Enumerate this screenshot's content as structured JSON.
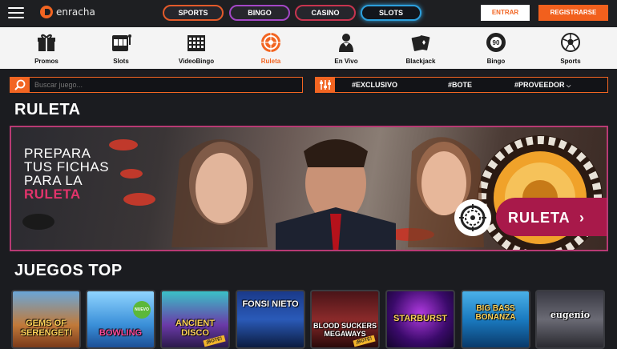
{
  "header": {
    "logo_text": "enracha",
    "tabs": [
      "SPORTS",
      "BINGO",
      "CASINO",
      "SLOTS"
    ],
    "login_label": "ENTRAR",
    "register_label": "REGISTRARSE"
  },
  "categories": [
    {
      "label": "Promos",
      "icon": "gift-icon"
    },
    {
      "label": "Slots",
      "icon": "slot-machine-icon"
    },
    {
      "label": "VideoBingo",
      "icon": "bingo-card-icon"
    },
    {
      "label": "Ruleta",
      "icon": "roulette-icon",
      "active": true
    },
    {
      "label": "En Vivo",
      "icon": "live-dealer-icon"
    },
    {
      "label": "Blackjack",
      "icon": "cards-icon"
    },
    {
      "label": "Bingo",
      "icon": "bingo-ball-icon"
    },
    {
      "label": "Sports",
      "icon": "soccer-ball-icon"
    }
  ],
  "search": {
    "placeholder": "Buscar juego..."
  },
  "filters": [
    "#EXCLUSIVO",
    "#BOTE",
    "#PROVEEDOR"
  ],
  "section_title": "RULETA",
  "banner": {
    "line1": "PREPARA",
    "line2": "TUS FICHAS",
    "line3": "PARA LA",
    "line4": "RULETA",
    "cta_label": "RULETA"
  },
  "top_games_title": "JUEGOS TOP",
  "games": [
    {
      "title": "GEMS OF SERENGETI",
      "badge": ""
    },
    {
      "title": "BOWLING",
      "badge": "NUEVO"
    },
    {
      "title": "ANCIENT DISCO",
      "badge": "¡BOTE!"
    },
    {
      "title": "FONSI NIETO",
      "badge": ""
    },
    {
      "title": "BLOOD SUCKERS MEGAWAYS",
      "badge": "¡BOTE!"
    },
    {
      "title": "STARBURST",
      "badge": ""
    },
    {
      "title": "BIG BASS BONANZA",
      "badge": ""
    },
    {
      "title": "eugenio",
      "badge": ""
    }
  ],
  "colors": {
    "accent": "#f26522",
    "banner_border": "#b83a74",
    "cta": "#a8194a"
  }
}
